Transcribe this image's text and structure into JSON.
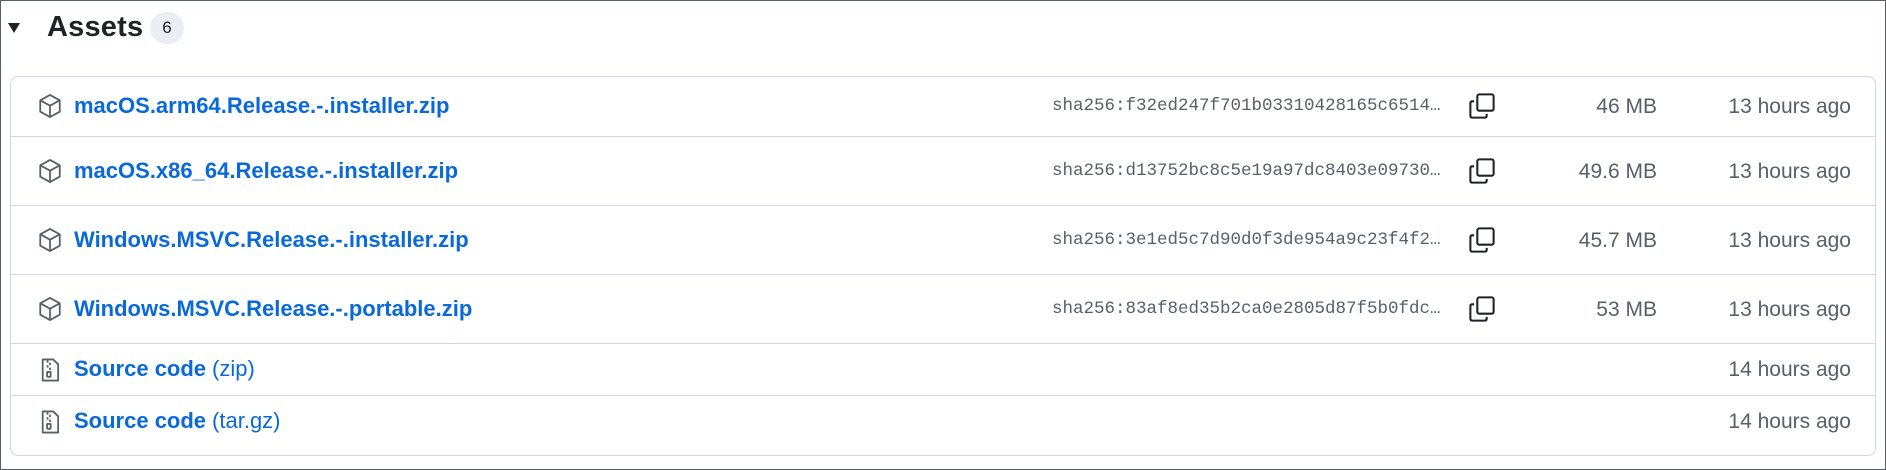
{
  "header": {
    "title": "Assets",
    "count": "6"
  },
  "assets": [
    {
      "name": "macOS.arm64.Release.-.installer.zip",
      "sha": "sha256:f32ed247f701b03310428165c6514…",
      "size": "46 MB",
      "time": "13 hours ago",
      "icon": "package-icon"
    },
    {
      "name": "macOS.x86_64.Release.-.installer.zip",
      "sha": "sha256:d13752bc8c5e19a97dc8403e09730…",
      "size": "49.6 MB",
      "time": "13 hours ago",
      "icon": "package-icon"
    },
    {
      "name": "Windows.MSVC.Release.-.installer.zip",
      "sha": "sha256:3e1ed5c7d90d0f3de954a9c23f4f2…",
      "size": "45.7 MB",
      "time": "13 hours ago",
      "icon": "package-icon"
    },
    {
      "name": "Windows.MSVC.Release.-.portable.zip",
      "sha": "sha256:83af8ed35b2ca0e2805d87f5b0fdc…",
      "size": "53 MB",
      "time": "13 hours ago",
      "icon": "package-icon"
    }
  ],
  "sources": [
    {
      "name": "Source code",
      "format": "(zip)",
      "time": "14 hours ago",
      "icon": "file-zip-icon"
    },
    {
      "name": "Source code",
      "format": "(tar.gz)",
      "time": "14 hours ago",
      "icon": "file-zip-icon"
    }
  ],
  "colors": {
    "link": "#0969da",
    "muted": "#57606a",
    "border": "#d0d7de",
    "badge_bg": "#eaeef2"
  }
}
